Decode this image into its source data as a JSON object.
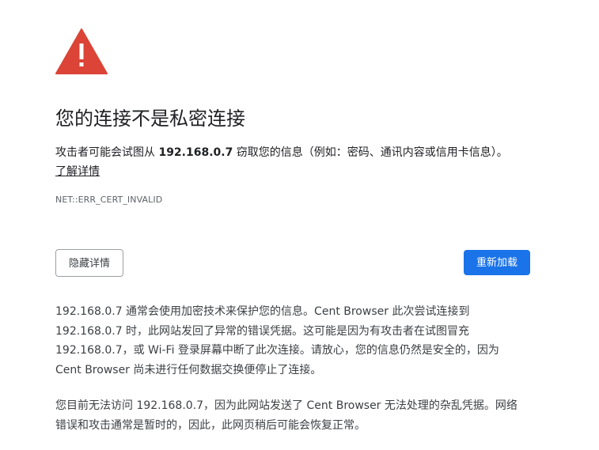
{
  "page": {
    "title": "您的连接不是私密连接"
  },
  "intro": {
    "prefix": "攻击者可能会试图从 ",
    "host": "192.168.0.7",
    "suffix": " 窃取您的信息（例如：密码、通讯内容或信用卡信息）。",
    "learn_more": "了解详情"
  },
  "error_code": "NET::ERR_CERT_INVALID",
  "buttons": {
    "hide_details": "隐藏详情",
    "reload": "重新加载"
  },
  "details": {
    "paragraph1_lines": [
      "192.168.0.7 通常会使用加密技术来保护您的信息。Cent Browser 此次尝试连接到",
      "192.168.0.7 时，此网站发回了异常的错误凭据。这可能是因为有攻击者在试图冒充",
      "192.168.0.7，或 Wi-Fi 登录屏幕中断了此次连接。请放心，您的信息仍然是安全的，因为",
      "Cent Browser 尚未进行任何数据交换便停止了连接。"
    ],
    "paragraph2_lines": [
      "您目前无法访问 192.168.0.7，因为此网站发送了 Cent Browser 无法处理的杂乱凭据。网络",
      "错误和攻击通常是暂时的，因此，此网页稍后可能会恢复正常。"
    ]
  },
  "colors": {
    "warning_red": "#db4437",
    "primary_blue": "#1a73e8"
  },
  "icons": {
    "warning": "warning-triangle-icon"
  }
}
